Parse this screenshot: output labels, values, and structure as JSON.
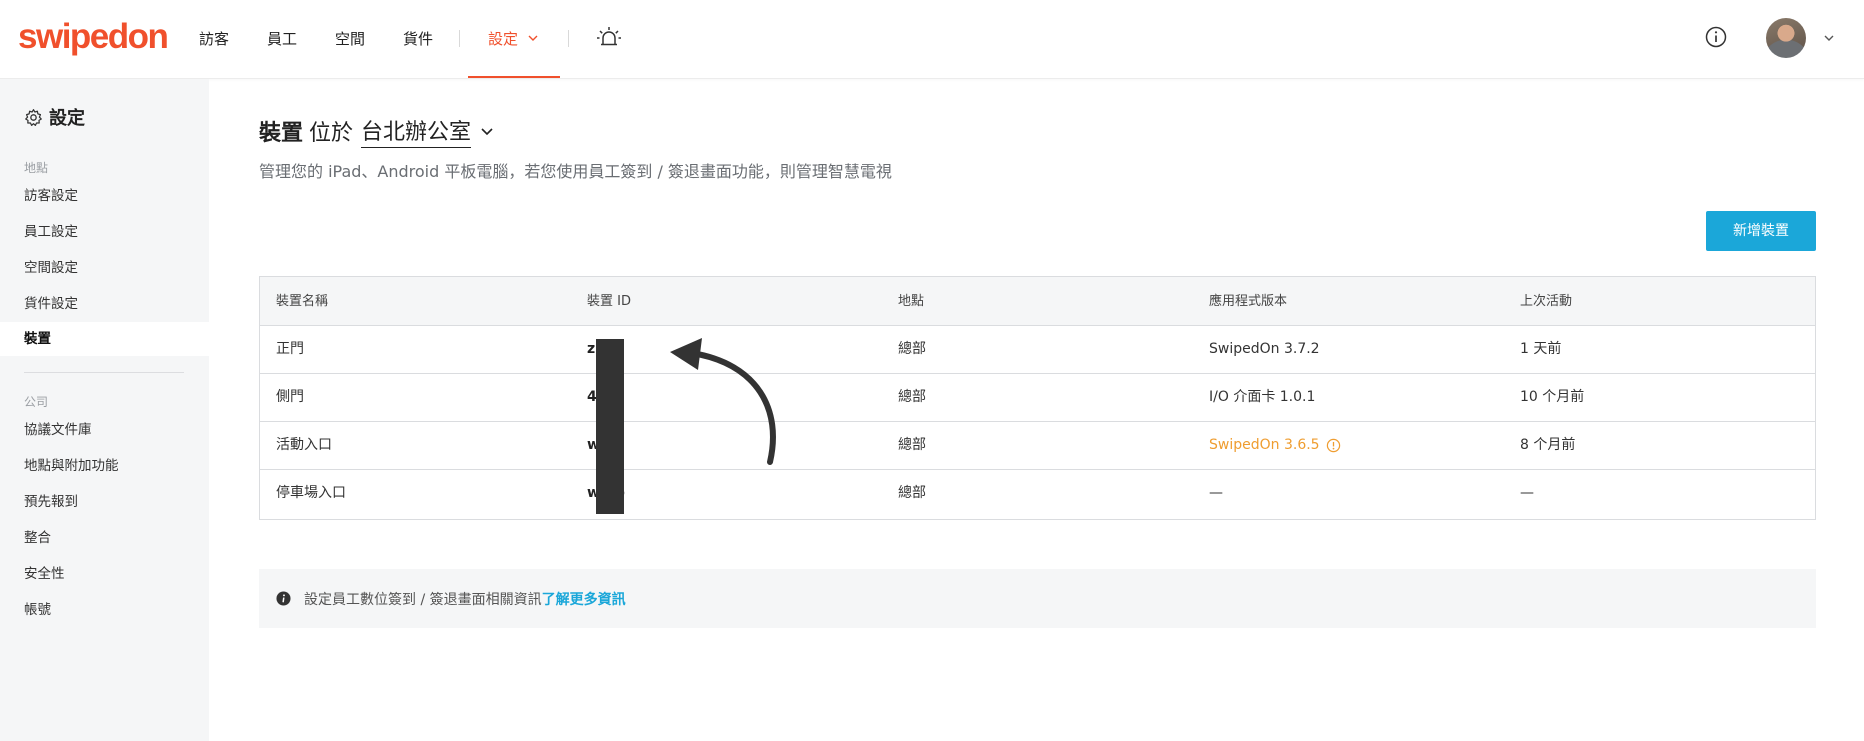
{
  "app": {
    "logo_text": "swipedon",
    "brand_color": "#f0502c",
    "accent_color": "#1ba7d9"
  },
  "nav": {
    "items": [
      {
        "label": "訪客"
      },
      {
        "label": "員工"
      },
      {
        "label": "空間"
      },
      {
        "label": "貨件"
      },
      {
        "label": "設定",
        "active": true
      }
    ],
    "icons": [
      "alarm-icon",
      "info-icon",
      "avatar",
      "chevron-down-icon"
    ]
  },
  "sidebar": {
    "title": "設定",
    "sections": [
      {
        "label": "地點",
        "items": [
          "訪客設定",
          "員工設定",
          "空間設定",
          "貨件設定",
          "裝置"
        ]
      },
      {
        "label": "公司",
        "items": [
          "協議文件庫",
          "地點與附加功能",
          "預先報到",
          "整合",
          "安全性",
          "帳號"
        ]
      }
    ],
    "active_item": "裝置"
  },
  "main": {
    "heading_bold": "裝置",
    "heading_mid": "位於",
    "location": "台北辦公室",
    "subtitle": "管理您的 iPad、Android 平板電腦，若您使用員工簽到 / 簽退畫面功能，則管理智慧電視",
    "add_button": "新增裝置",
    "table": {
      "headers": [
        "裝置名稱",
        "裝置 ID",
        "地點",
        "應用程式版本",
        "上次活動"
      ],
      "rows": [
        {
          "name": "正門",
          "id": "z     g",
          "location": "總部",
          "version": "SwipedOn 3.7.2",
          "last": "1 天前",
          "warning": false
        },
        {
          "name": "側門",
          "id": "4     e5",
          "location": "總部",
          "version": "I/O 介面卡 1.0.1",
          "last": "10 个月前",
          "warning": false
        },
        {
          "name": "活動入口",
          "id": "w     ze",
          "location": "總部",
          "version": "SwipedOn 3.6.5",
          "last": "8 个月前",
          "warning": true
        },
        {
          "name": "停車場入口",
          "id": "w     db",
          "location": "總部",
          "version": "—",
          "last": "—",
          "warning": false
        }
      ]
    },
    "info_text": "設定員工數位簽到 / 簽退畫面相關資訊",
    "info_link": "了解更多資訊",
    "warning_color": "#ef9d30"
  }
}
